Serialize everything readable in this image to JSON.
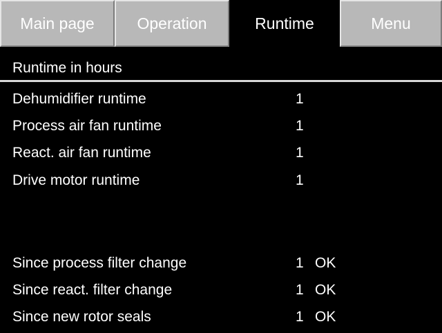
{
  "tabs": [
    {
      "label": "Main page"
    },
    {
      "label": "Operation"
    },
    {
      "label": "Runtime"
    },
    {
      "label": "Menu"
    }
  ],
  "section_title": "Runtime in hours",
  "runtime_rows": [
    {
      "label": "Dehumidifier runtime",
      "value": "1"
    },
    {
      "label": "Process air fan runtime",
      "value": "1"
    },
    {
      "label": "React. air fan runtime",
      "value": "1"
    },
    {
      "label": "Drive motor runtime",
      "value": "1"
    }
  ],
  "maintenance_rows": [
    {
      "label": "Since process filter change",
      "value": "1",
      "status": "OK"
    },
    {
      "label": "Since react. filter change",
      "value": "1",
      "status": "OK"
    },
    {
      "label": "Since new rotor seals",
      "value": "1",
      "status": "OK"
    }
  ],
  "colors": {
    "background": "#000000",
    "text": "#ffffff",
    "inactive_tab": "#b8b8b8",
    "divider": "#d8d8d8"
  }
}
